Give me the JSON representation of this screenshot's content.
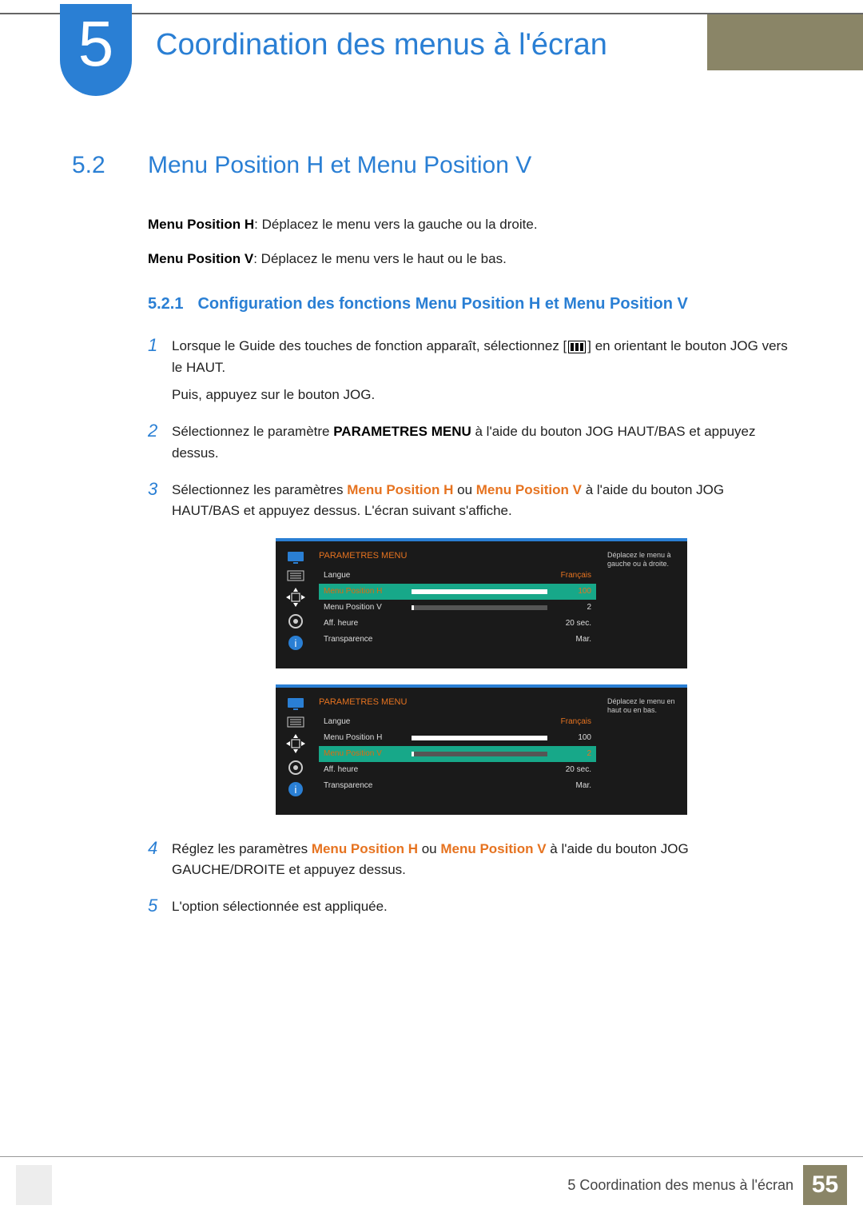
{
  "chapter": {
    "number": "5",
    "title": "Coordination des menus à l'écran"
  },
  "section": {
    "number": "5.2",
    "title": "Menu Position H et Menu Position V"
  },
  "description": {
    "h_label": "Menu Position H",
    "h_text": ": Déplacez le menu vers la gauche ou la droite.",
    "v_label": "Menu Position V",
    "v_text": ": Déplacez le menu vers le haut ou le bas."
  },
  "subsection": {
    "number": "5.2.1",
    "title": "Configuration des fonctions Menu Position H et Menu Position V"
  },
  "steps": [
    {
      "num": "1",
      "text_a": "Lorsque le Guide des touches de fonction apparaît, sélectionnez [",
      "text_b": "] en orientant le bouton JOG vers le HAUT.",
      "text_c": "Puis, appuyez sur le bouton JOG."
    },
    {
      "num": "2",
      "text_a": "Sélectionnez le paramètre ",
      "bold_a": "PARAMETRES MENU",
      "text_b": " à l'aide du bouton JOG HAUT/BAS et appuyez dessus."
    },
    {
      "num": "3",
      "text_a": "Sélectionnez les paramètres ",
      "em_a": "Menu Position H",
      "text_b": " ou ",
      "em_b": "Menu Position V",
      "text_c": " à l'aide du bouton JOG HAUT/BAS et appuyez dessus. L'écran suivant s'affiche."
    },
    {
      "num": "4",
      "text_a": "Réglez les paramètres ",
      "em_a": "Menu Position H",
      "text_b": " ou ",
      "em_b": "Menu Position V",
      "text_c": " à l'aide du bouton JOG GAUCHE/DROITE et appuyez dessus."
    },
    {
      "num": "5",
      "text_a": "L'option sélectionnée est appliquée."
    }
  ],
  "osd": {
    "title": "PARAMETRES MENU",
    "rows": [
      {
        "label": "Langue",
        "value": "Français",
        "type": "text"
      },
      {
        "label": "Menu Position H",
        "value": "100",
        "type": "bar",
        "fill": 100
      },
      {
        "label": "Menu Position V",
        "value": "2",
        "type": "bar",
        "fill": 2
      },
      {
        "label": "Aff. heure",
        "value": "20 sec.",
        "type": "text"
      },
      {
        "label": "Transparence",
        "value": "Mar.",
        "type": "text"
      }
    ],
    "tip_h": "Déplacez le menu à gauche ou à droite.",
    "tip_v": "Déplacez le menu en haut ou en bas."
  },
  "footer": {
    "label": "5 Coordination des menus à l'écran",
    "page": "55"
  }
}
